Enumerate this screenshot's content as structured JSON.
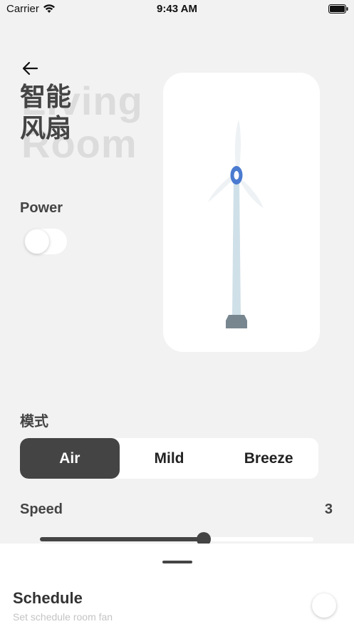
{
  "status_bar": {
    "carrier": "Carrier",
    "time": "9:43 AM"
  },
  "header": {
    "title_bg": "Living\nRoom",
    "title": "智能风扇"
  },
  "power": {
    "label": "Power",
    "on": false
  },
  "mode": {
    "label": "模式",
    "options": [
      {
        "label": "Air",
        "selected": true
      },
      {
        "label": "Mild",
        "selected": false
      },
      {
        "label": "Breeze",
        "selected": false
      }
    ]
  },
  "speed": {
    "label": "Speed",
    "value": "3",
    "level": 0.6
  },
  "sheet": {
    "title": "Schedule",
    "subtitle": "Set schedule room fan",
    "schedule_on": false
  },
  "colors": {
    "accent": "#444444",
    "hub": "#4a7bd0",
    "tower": "#cfe0e8",
    "base": "#78868f"
  }
}
